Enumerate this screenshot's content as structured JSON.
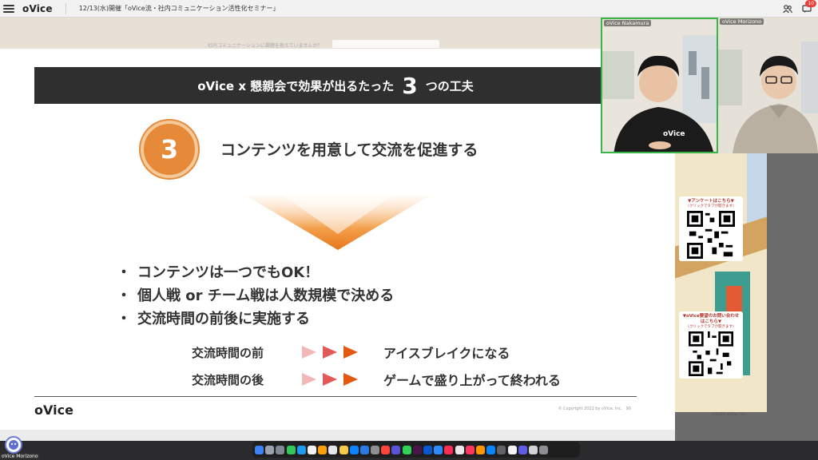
{
  "topbar": {
    "logo": "oVice",
    "title": "12/13(水)開催「oVice流・社内コミュニケーション活性化セミナー」",
    "notification_count": "10"
  },
  "map_strip": {
    "faint_text": "社内コミュニケーションに課題を抱えていませんか？"
  },
  "slide": {
    "header_prefix": "oVice x 懇親会で効果が出るたった",
    "header_number": "3",
    "header_suffix": "つの工夫",
    "point_number": "3",
    "point_title": "コンテンツを用意して交流を促進する",
    "bullets": [
      "コンテンツは一つでもOK！",
      "個人戦 or チーム戦は人数規模で決める",
      "交流時間の前後に実施する"
    ],
    "bullet_mark": "・",
    "rows": [
      {
        "label": "交流時間の前",
        "value": "アイスブレイクになる"
      },
      {
        "label": "交流時間の後",
        "value": "ゲームで盛り上がって終われる"
      }
    ],
    "footer_logo": "oVice",
    "copyright": "© Copyright 2022 by oVice, Inc.",
    "page_number": "90"
  },
  "video_tiles": [
    {
      "name": "oVice Nakamura",
      "active": true
    },
    {
      "name": "oVice Morizono",
      "active": false
    }
  ],
  "qr_cards": [
    {
      "caption": "▼アンケートはこちら▼",
      "sub": "(クリックでタブが開きます)"
    },
    {
      "caption": "▼oVice要望のお問い合わせはこちら▼",
      "sub": "(クリックでタブが開きます)"
    }
  ],
  "map_footer": "©2020 oVice, Inc.",
  "self_user": {
    "name": "oVice Morizono"
  },
  "colors": {
    "accent_orange": "#e68a3a",
    "arrow_light": "#f2b8b8",
    "arrow_mid": "#e2595a",
    "arrow_dark": "#e2590f",
    "active_tile_border": "#39b54a"
  }
}
